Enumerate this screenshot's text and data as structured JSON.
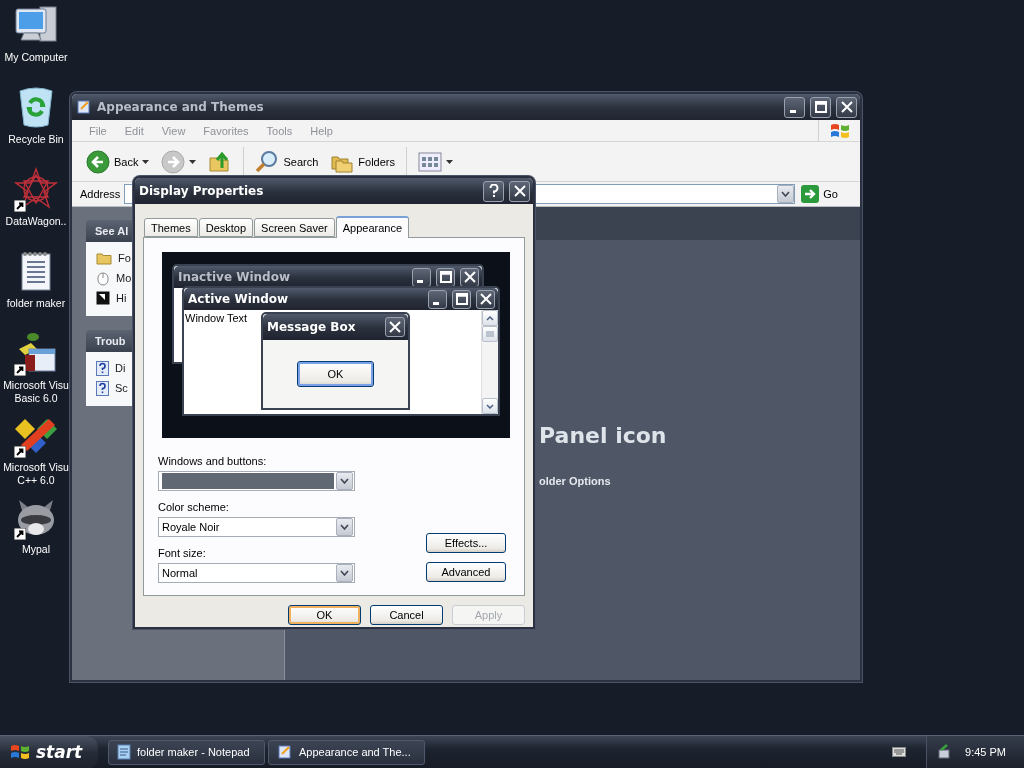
{
  "desktop_icons": [
    {
      "label": "My Computer",
      "kind": "computer",
      "shortcut": false
    },
    {
      "label": "Recycle Bin",
      "kind": "recycle",
      "shortcut": false
    },
    {
      "label": "DataWagon..",
      "kind": "star",
      "shortcut": true
    },
    {
      "label": "folder maker",
      "kind": "notepad",
      "shortcut": false
    },
    {
      "label": "Microsoft Visu\nBasic 6.0",
      "kind": "vb",
      "shortcut": true
    },
    {
      "label": "Microsoft Visu\nC++ 6.0",
      "kind": "vc",
      "shortcut": true
    },
    {
      "label": "Mypal",
      "kind": "animal",
      "shortcut": true
    }
  ],
  "explorer": {
    "title": "Appearance and Themes",
    "menu": [
      "File",
      "Edit",
      "View",
      "Favorites",
      "Tools",
      "Help"
    ],
    "toolbar": {
      "back": "Back",
      "search": "Search",
      "folders": "Folders"
    },
    "address": {
      "label": "Address",
      "go": "Go"
    },
    "task_pane": [
      {
        "title": "See Al",
        "items": [
          {
            "label": "Fo",
            "kind": "folder"
          },
          {
            "label": "Mo",
            "kind": "mouse"
          },
          {
            "label": "Hi",
            "kind": "hide"
          }
        ]
      },
      {
        "title": "Troub",
        "items": [
          {
            "label": "Di",
            "kind": "help"
          },
          {
            "label": "Sc",
            "kind": "help"
          }
        ]
      }
    ],
    "heading": "Panel icon",
    "link": "older Options"
  },
  "dialog": {
    "title": "Display Properties",
    "tabs": [
      {
        "label": "Themes",
        "selected": false
      },
      {
        "label": "Desktop",
        "selected": false
      },
      {
        "label": "Screen Saver",
        "selected": false
      },
      {
        "label": "Appearance",
        "selected": true
      }
    ],
    "preview": {
      "inactive_title": "Inactive Window",
      "active_title": "Active Window",
      "window_text": "Window Text",
      "message_title": "Message Box",
      "message_button": "OK"
    },
    "fields": [
      {
        "label": "Windows and buttons:",
        "kind": "swatch"
      },
      {
        "label": "Color scheme:",
        "kind": "text",
        "value": "Royale Noir"
      },
      {
        "label": "Font size:",
        "kind": "text",
        "value": "Normal"
      }
    ],
    "side_buttons": [
      "Effects...",
      "Advanced"
    ],
    "buttons": [
      {
        "label": "OK",
        "default": true,
        "disabled": false
      },
      {
        "label": "Cancel",
        "default": false,
        "disabled": false
      },
      {
        "label": "Apply",
        "default": false,
        "disabled": true
      }
    ]
  },
  "taskbar": {
    "start": "start",
    "tasks": [
      {
        "label": "folder maker - Notepad",
        "kind": "notepad"
      },
      {
        "label": "Appearance and The...",
        "kind": "explorer"
      }
    ],
    "clock": "9:45 PM"
  }
}
